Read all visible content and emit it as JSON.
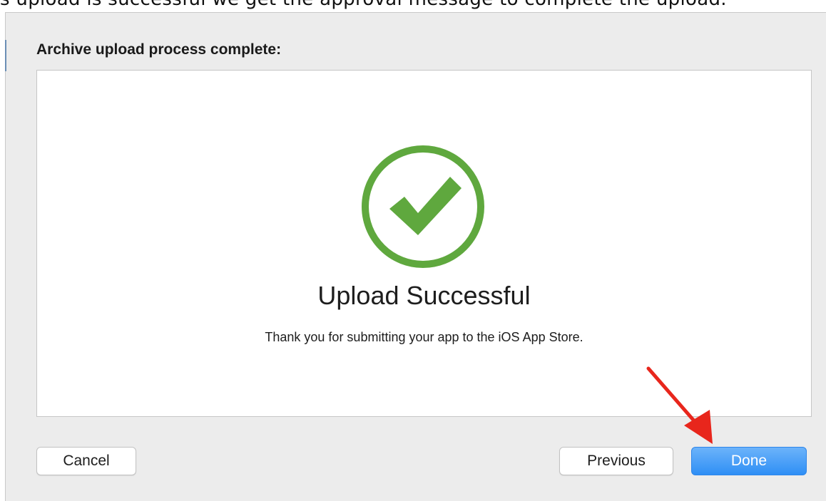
{
  "top_caption": "s upload is successful we get the approval message to complete the upload.",
  "dialog": {
    "heading": "Archive upload process complete:",
    "title": "Upload Successful",
    "message": "Thank you for submitting your app to the iOS App Store."
  },
  "buttons": {
    "cancel": "Cancel",
    "previous": "Previous",
    "done": "Done"
  },
  "icons": {
    "success": "checkmark-circle-icon",
    "annotation": "red-arrow-icon"
  },
  "colors": {
    "success_green": "#5fa83e",
    "primary_blue": "#3d96f6",
    "annotation_red": "#e8261c"
  }
}
